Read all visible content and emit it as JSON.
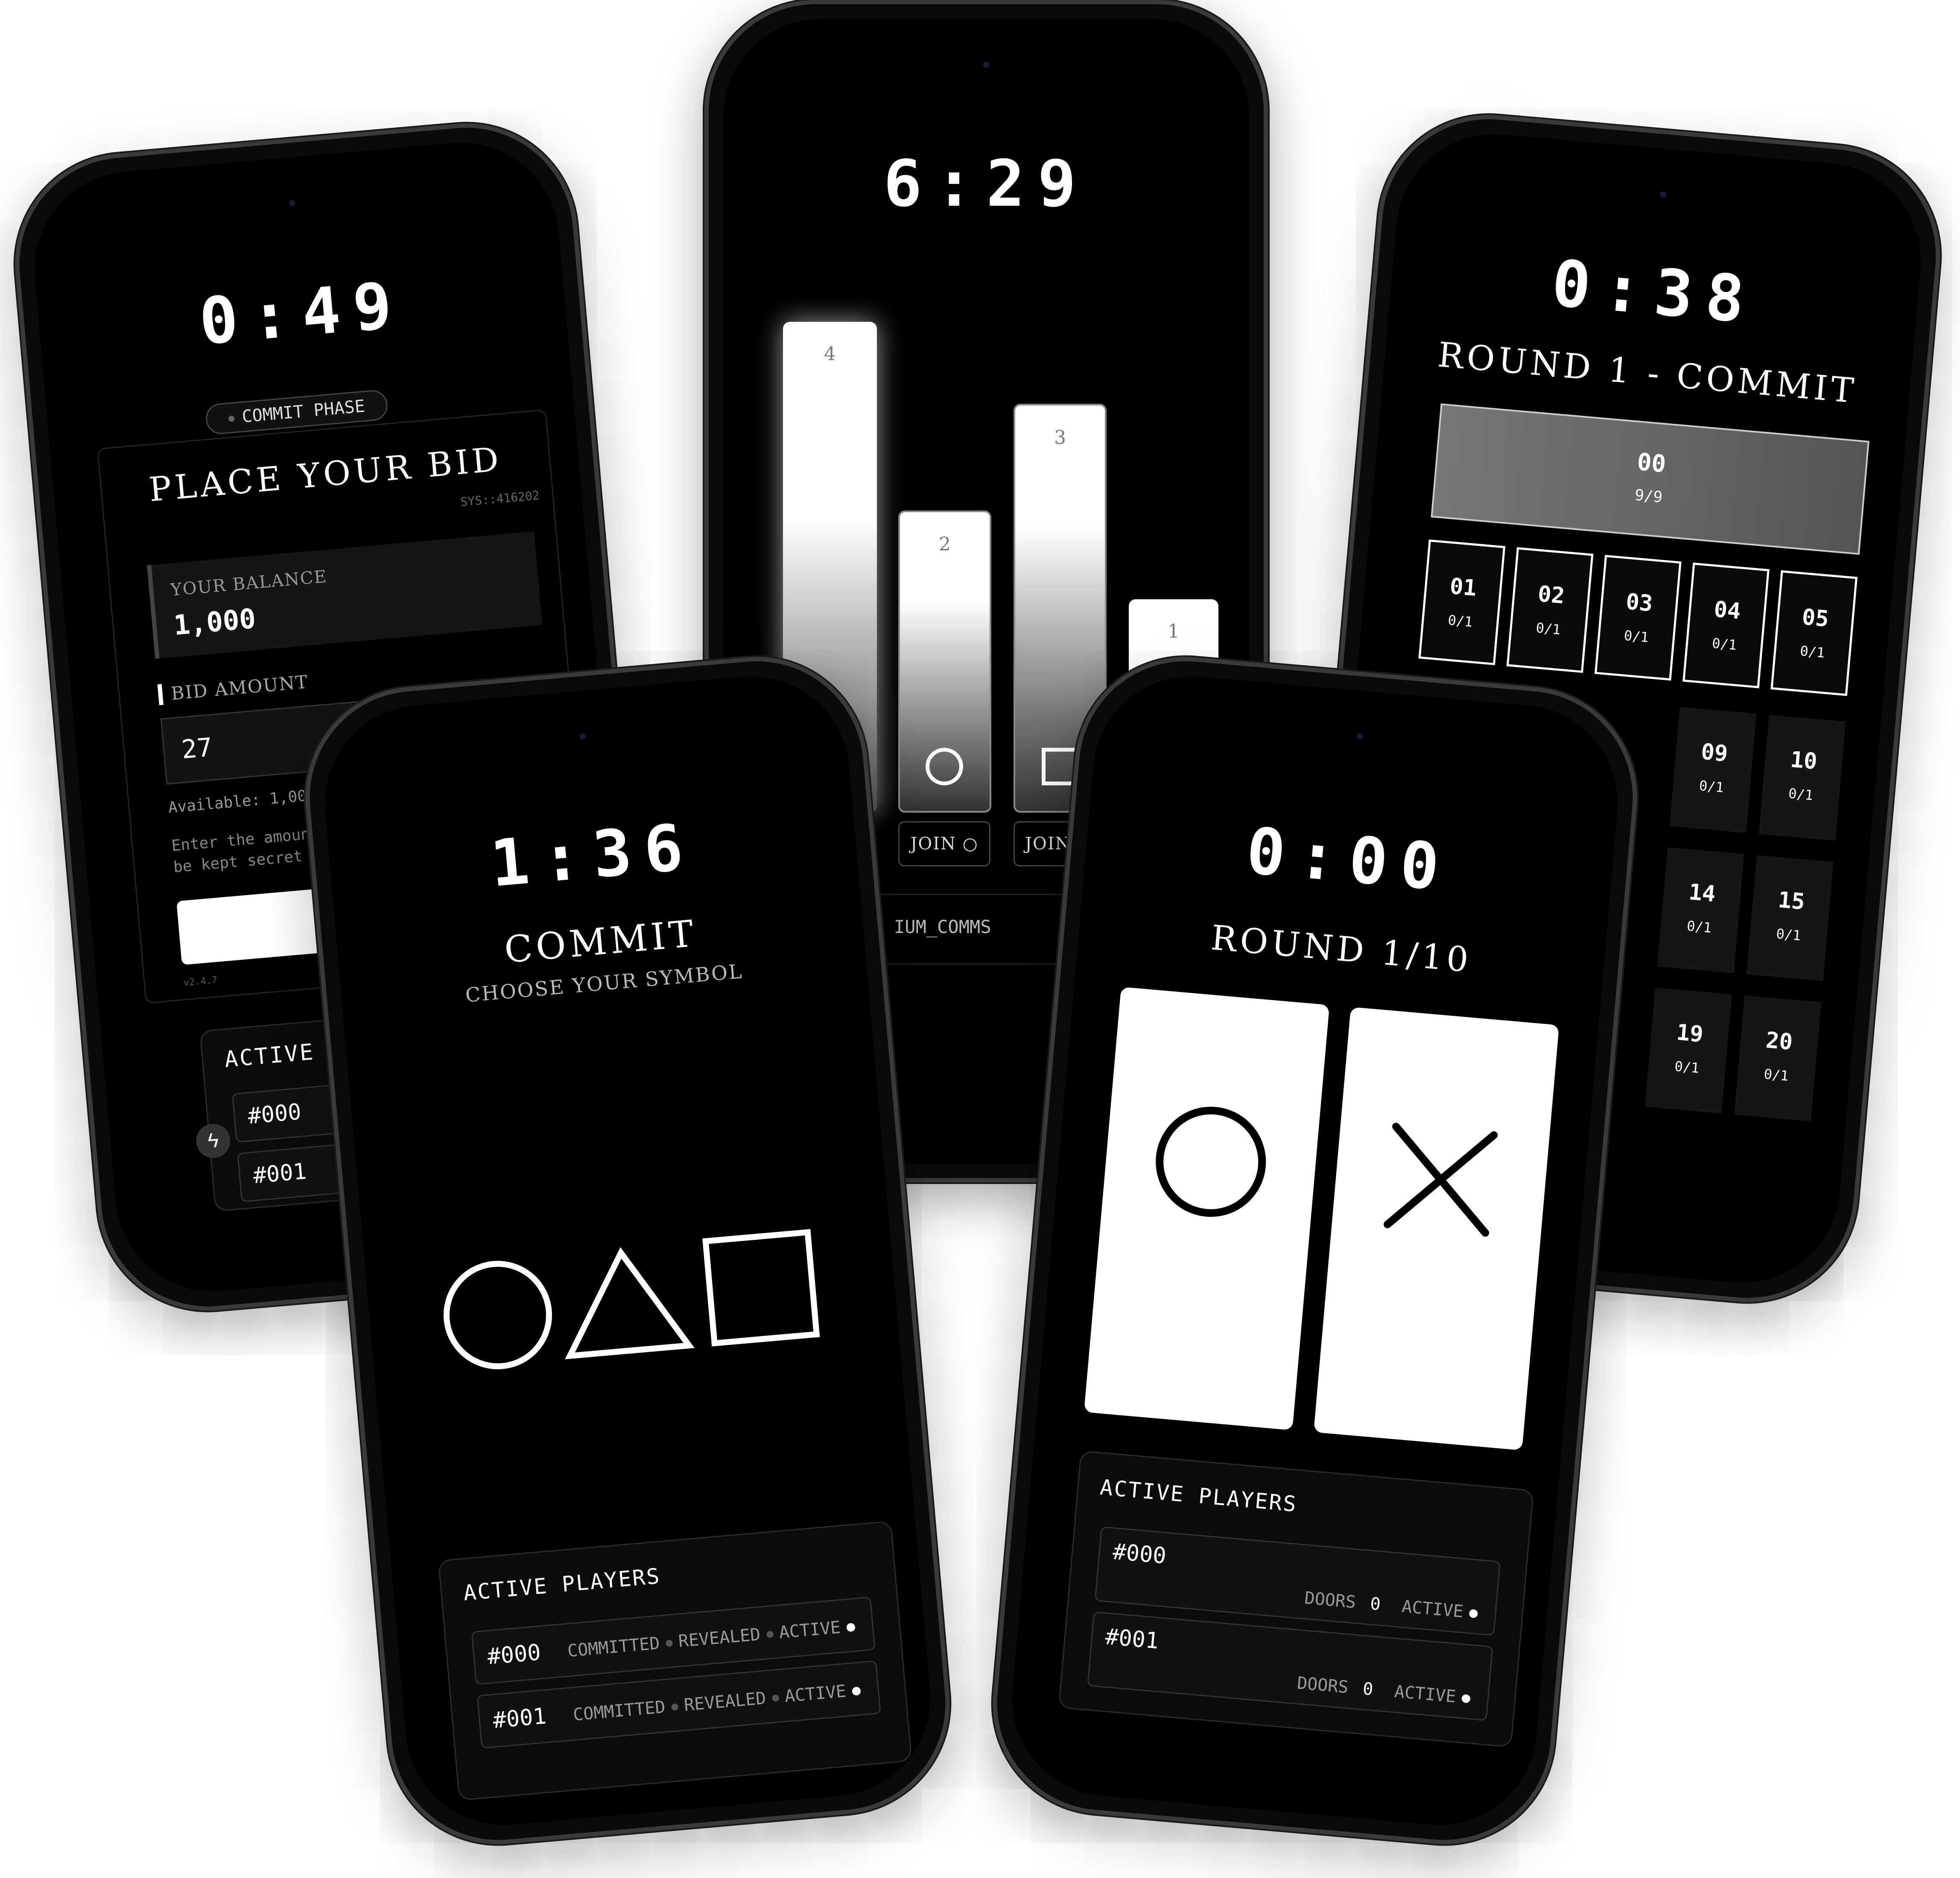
{
  "phone_bid": {
    "timer": "0:49",
    "phase_badge": "COMMIT PHASE",
    "title": "PLACE YOUR BID",
    "sys_id": "SYS::416202",
    "balance_label": "YOUR BALANCE",
    "balance_value": "1,000",
    "bid_label": "BID AMOUNT",
    "bid_value": "27",
    "available_text": "Available: 1,000",
    "hint_line1": "Enter the amount",
    "hint_line2": "be kept secret",
    "version": "v2.4.7",
    "players_title": "ACTIVE PLAYERS",
    "players": [
      "#000",
      "#001"
    ]
  },
  "phone_vote": {
    "timer": "6:29",
    "bars": [
      {
        "label": "4",
        "value": 4
      },
      {
        "label": "2",
        "value": 2,
        "symbol": "circle"
      },
      {
        "label": "3",
        "value": 3,
        "symbol": "square"
      },
      {
        "label": "1",
        "value": 1
      }
    ],
    "join_circle": "JOIN ○",
    "join_square": "JOIN □",
    "footer_text": "IUM_COMMS"
  },
  "phone_grid": {
    "timer": "0:38",
    "title": "ROUND 1 - COMMIT",
    "banner_number": "00",
    "banner_count": "9/9",
    "row1": [
      {
        "num": "01",
        "count": "0/1"
      },
      {
        "num": "02",
        "count": "0/1"
      },
      {
        "num": "03",
        "count": "0/1"
      },
      {
        "num": "04",
        "count": "0/1"
      },
      {
        "num": "05",
        "count": "0/1"
      }
    ],
    "cells_right": [
      {
        "num": "09",
        "count": "0/1"
      },
      {
        "num": "10",
        "count": "0/1"
      },
      {
        "num": "14",
        "count": "0/1"
      },
      {
        "num": "15",
        "count": "0/1"
      },
      {
        "num": "19",
        "count": "0/1"
      },
      {
        "num": "20",
        "count": "0/1"
      }
    ]
  },
  "phone_symbol": {
    "timer": "1:36",
    "title": "COMMIT",
    "subtitle": "CHOOSE YOUR SYMBOL",
    "players_title": "ACTIVE PLAYERS",
    "players": [
      {
        "id": "#000",
        "committed": "COMMITTED",
        "revealed": "REVEALED",
        "status": "ACTIVE"
      },
      {
        "id": "#001",
        "committed": "COMMITTED",
        "revealed": "REVEALED",
        "status": "ACTIVE"
      }
    ]
  },
  "phone_doors": {
    "timer": "0:00",
    "title": "ROUND 1/10",
    "players_title": "ACTIVE PLAYERS",
    "players": [
      {
        "id": "#000",
        "doors_label": "DOORS",
        "doors": "0",
        "status": "ACTIVE"
      },
      {
        "id": "#001",
        "doors_label": "DOORS",
        "doors": "0",
        "status": "ACTIVE"
      }
    ]
  }
}
